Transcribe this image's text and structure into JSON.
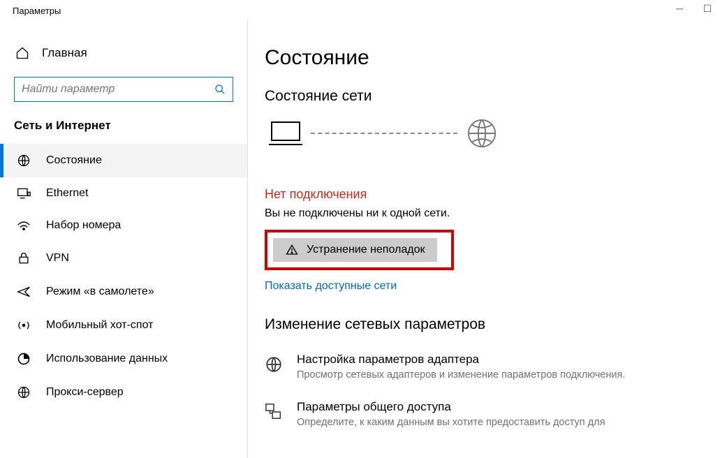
{
  "window": {
    "title": "Параметры"
  },
  "sidebar": {
    "home": "Главная",
    "search_placeholder": "Найти параметр",
    "section": "Сеть и Интернет",
    "items": [
      {
        "label": "Состояние"
      },
      {
        "label": "Ethernet"
      },
      {
        "label": "Набор номера"
      },
      {
        "label": "VPN"
      },
      {
        "label": "Режим «в самолете»"
      },
      {
        "label": "Мобильный хот-спот"
      },
      {
        "label": "Использование данных"
      },
      {
        "label": "Прокси-сервер"
      }
    ]
  },
  "main": {
    "title": "Состояние",
    "status_heading": "Состояние сети",
    "no_connection_title": "Нет подключения",
    "no_connection_msg": "Вы не подключены ни к одной сети.",
    "troubleshoot_label": "Устранение неполадок",
    "show_networks_link": "Показать доступные сети",
    "change_settings_heading": "Изменение сетевых параметров",
    "options": [
      {
        "title": "Настройка параметров адаптера",
        "desc": "Просмотр сетевых адаптеров и изменение параметров подключения."
      },
      {
        "title": "Параметры общего доступа",
        "desc": "Определите, к каким данным вы хотите предоставить доступ для"
      }
    ]
  }
}
